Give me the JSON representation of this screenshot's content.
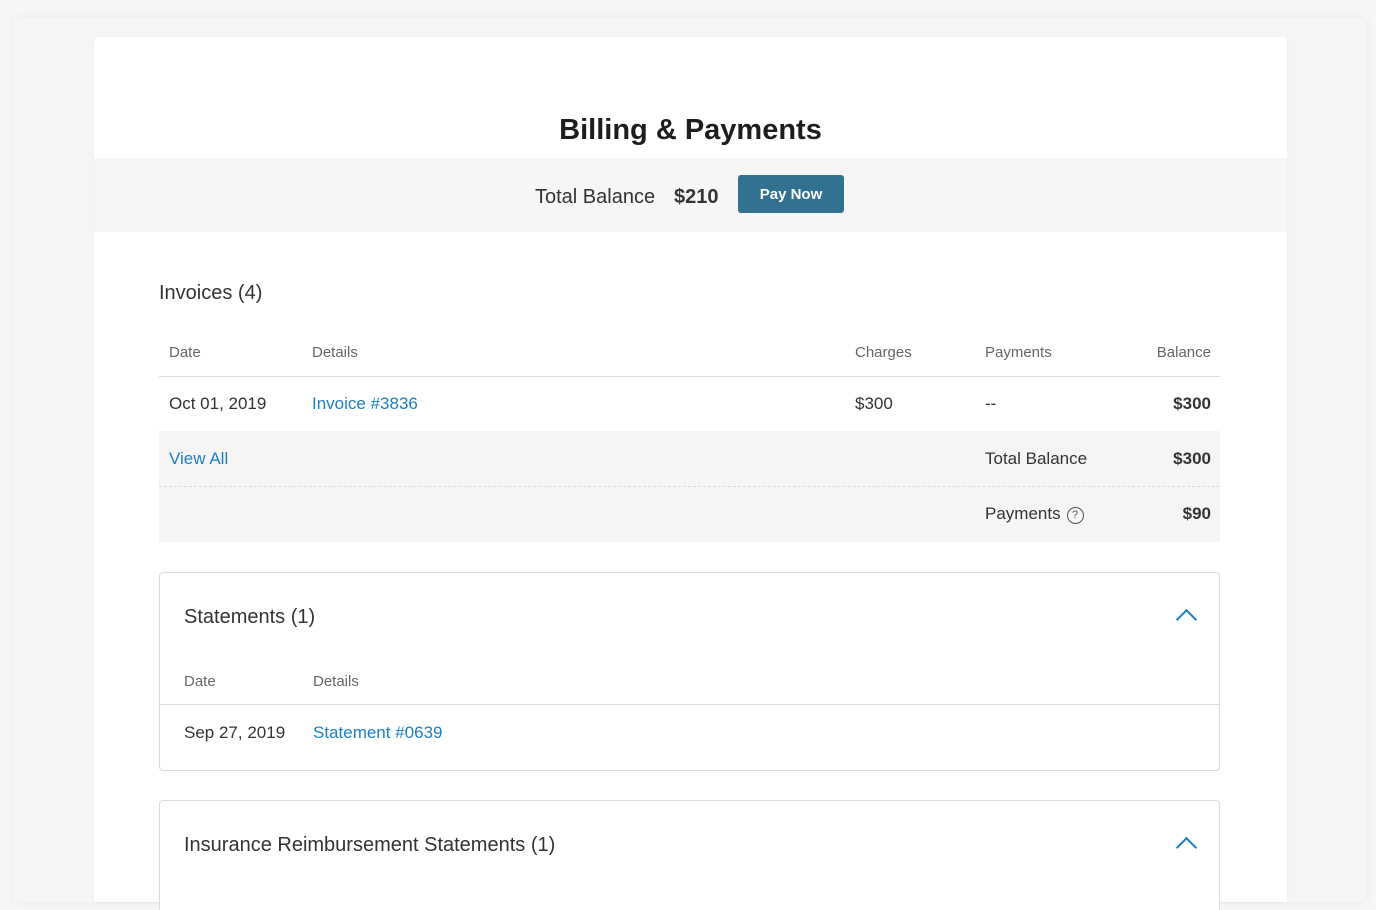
{
  "page": {
    "title": "Billing & Payments"
  },
  "balance": {
    "label": "Total Balance",
    "value": "$210",
    "pay_button": "Pay Now"
  },
  "invoices": {
    "heading": "Invoices (4)",
    "columns": {
      "date": "Date",
      "details": "Details",
      "charges": "Charges",
      "payments": "Payments",
      "balance": "Balance"
    },
    "rows": [
      {
        "date": "Oct 01, 2019",
        "details": "Invoice #3836",
        "charges": "$300",
        "payments": "--",
        "balance": "$300"
      }
    ],
    "view_all": "View All",
    "summary": {
      "total_balance_label": "Total Balance",
      "total_balance_value": "$300",
      "payments_label": "Payments",
      "payments_help": "?",
      "payments_value": "$90"
    }
  },
  "statements": {
    "heading": "Statements (1)",
    "columns": {
      "date": "Date",
      "details": "Details"
    },
    "rows": [
      {
        "date": "Sep 27, 2019",
        "details": "Statement #0639"
      }
    ]
  },
  "insurance": {
    "heading": "Insurance Reimbursement Statements (1)"
  },
  "colors": {
    "primary_button": "#337190",
    "link": "#1b7fc4"
  }
}
